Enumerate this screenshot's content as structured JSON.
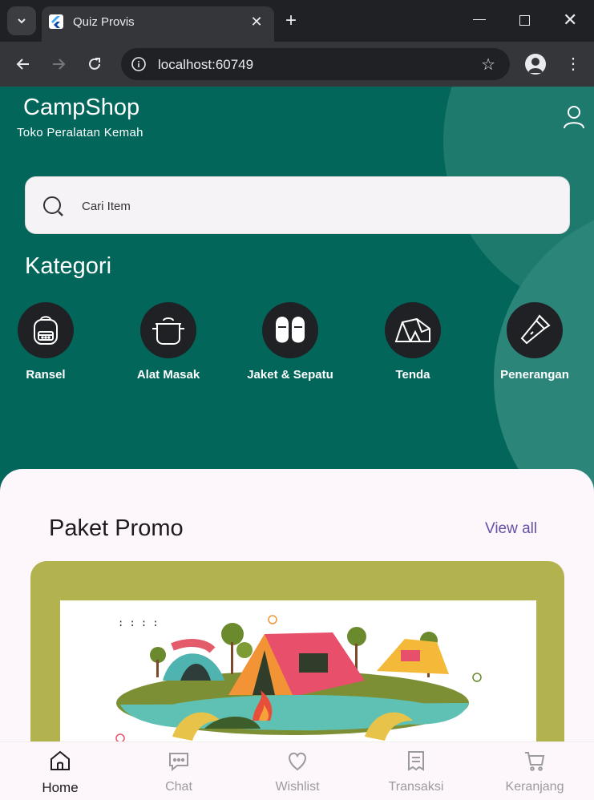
{
  "browser": {
    "tab_title": "Quiz Provis",
    "url": "localhost:60749"
  },
  "app": {
    "brand": "CampShop",
    "tagline": "Toko Peralatan Kemah",
    "search": {
      "placeholder": "Cari Item"
    },
    "kategori_title": "Kategori",
    "categories": [
      {
        "label": "Ransel",
        "icon": "backpack-icon"
      },
      {
        "label": "Alat Masak",
        "icon": "pot-icon"
      },
      {
        "label": "Jaket & Sepatu",
        "icon": "slippers-icon"
      },
      {
        "label": "Tenda",
        "icon": "tent-icon"
      },
      {
        "label": "Penerangan",
        "icon": "flashlight-icon"
      }
    ],
    "promo": {
      "title": "Paket Promo",
      "view_all": "View all"
    },
    "bottom_nav": [
      {
        "label": "Home",
        "icon": "home-icon",
        "active": true
      },
      {
        "label": "Chat",
        "icon": "chat-icon",
        "active": false
      },
      {
        "label": "Wishlist",
        "icon": "heart-icon",
        "active": false
      },
      {
        "label": "Transaksi",
        "icon": "receipt-icon",
        "active": false
      },
      {
        "label": "Keranjang",
        "icon": "cart-icon",
        "active": false
      }
    ]
  },
  "colors": {
    "primary": "#02675a",
    "sheet": "#fdf6fb",
    "accent": "#6750a4",
    "promo_card": "#b2b34f"
  }
}
